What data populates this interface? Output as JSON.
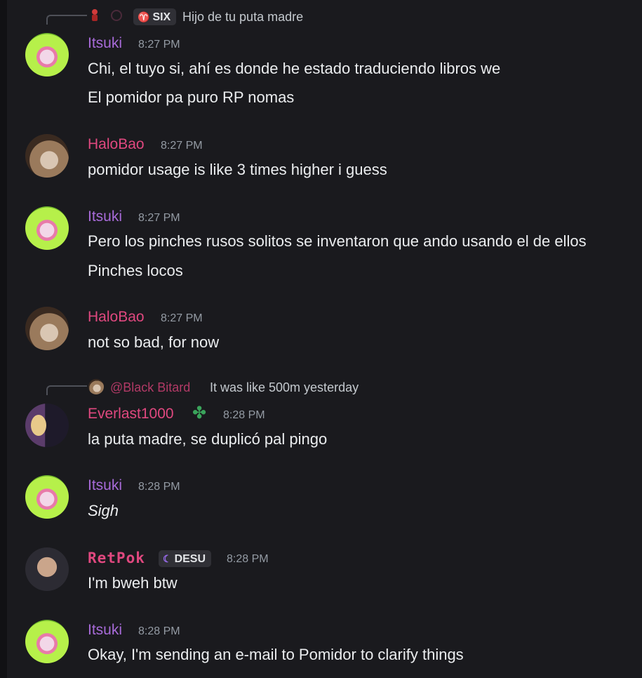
{
  "messages": [
    {
      "reply": {
        "tag": "SIX",
        "text": "Hijo de tu puta madre"
      },
      "author": "Itsuki",
      "time": "8:27 PM",
      "lines": [
        "Chi, el tuyo si, ahí es donde he estado traduciendo libros we",
        "El pomidor pa puro RP nomas"
      ]
    },
    {
      "author": "HaloBao",
      "time": "8:27 PM",
      "lines": [
        "pomidor usage is like 3 times higher i guess"
      ]
    },
    {
      "author": "Itsuki",
      "time": "8:27 PM",
      "lines": [
        "Pero los pinches rusos solitos se inventaron que ando usando el de ellos",
        "Pinches locos"
      ]
    },
    {
      "author": "HaloBao",
      "time": "8:27 PM",
      "lines": [
        "not so bad, for now"
      ]
    },
    {
      "reply": {
        "mention": "@Black Bitard",
        "text": "It was like 500m yesterday"
      },
      "author": "Everlast1000",
      "time": "8:28 PM",
      "lines": [
        "la puta madre, se duplicó pal pingo"
      ]
    },
    {
      "author": "Itsuki",
      "time": "8:28 PM",
      "lines": [
        "Sigh"
      ]
    },
    {
      "author": "RetPok",
      "tag": "DESU",
      "time": "8:28 PM",
      "lines": [
        "I'm bweh btw"
      ]
    },
    {
      "author": "Itsuki",
      "time": "8:28 PM",
      "lines": [
        "Okay, I'm sending an e-mail to Pomidor to clarify things"
      ]
    }
  ],
  "colors": {
    "background": "#1a1a1e",
    "itsuki": "#a86bd9",
    "pink": "#e0487f",
    "timestamp": "#949ba4",
    "text": "#ebedef"
  },
  "icons": {
    "reply_tag": "goat-icon",
    "server_tag": "moon-icon",
    "badge": "clover-icon"
  }
}
